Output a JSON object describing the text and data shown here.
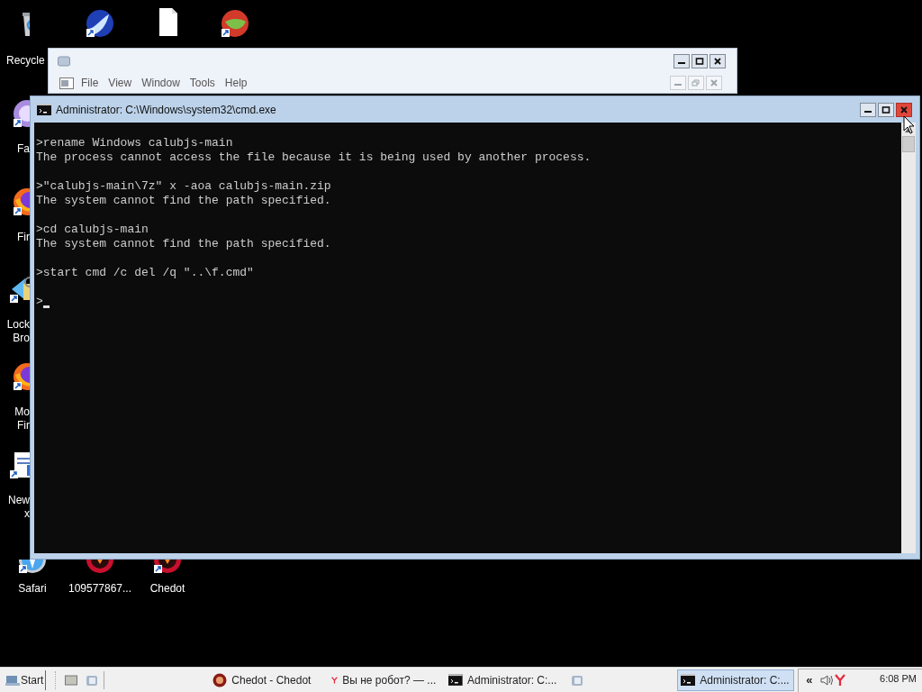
{
  "desktop_icons": [
    {
      "kind": "recycle",
      "shortcut": false,
      "label_lines": [
        "Recycle"
      ]
    },
    {
      "kind": "bird",
      "shortcut": true
    },
    {
      "kind": "document",
      "shortcut": false
    },
    {
      "kind": "chameleon",
      "shortcut": true
    },
    {
      "kind": "purple-globe",
      "shortcut": true,
      "label_lines": [
        "Fa"
      ]
    },
    {
      "kind": "firefox",
      "shortcut": true,
      "label_lines": [
        "Fir"
      ]
    },
    {
      "kind": "lock-browser",
      "shortcut": true,
      "label_lines": [
        "Lock",
        "Bro"
      ]
    },
    {
      "kind": "firefox",
      "shortcut": true,
      "label_lines": [
        "Mo",
        "Fir"
      ]
    },
    {
      "kind": "notepad",
      "shortcut": true,
      "label_lines": [
        "New",
        "x"
      ]
    },
    {
      "kind": "safari",
      "shortcut": true,
      "label_lines": [
        "Safari"
      ]
    },
    {
      "kind": "chedot",
      "shortcut": false,
      "label_lines": [
        "109577867..."
      ]
    },
    {
      "kind": "chedot",
      "shortcut": true,
      "label_lines": [
        "Chedot"
      ]
    }
  ],
  "back_window": {
    "menu": [
      "File",
      "View",
      "Window",
      "Tools",
      "Help"
    ]
  },
  "cmd_window": {
    "title": "Administrator: C:\\Windows\\system32\\cmd.exe",
    "close_hovered": true,
    "blocks": [
      {
        "command": ">rename Windows calubjs-main",
        "output": "The process cannot access the file because it is being used by another process."
      },
      {
        "command": ">\"calubjs-main\\7z\" x -aoa calubjs-main.zip",
        "output": "The system cannot find the path specified."
      },
      {
        "command": ">cd calubjs-main",
        "output": "The system cannot find the path specified."
      },
      {
        "command": ">start cmd /c del /q \"..\\f.cmd\""
      }
    ],
    "prompt": ">",
    "cursor": true
  },
  "taskbar": {
    "start": "Start",
    "tasks": [
      {
        "kind": "chedot",
        "label": "Chedot - Chedot",
        "selected": false
      },
      {
        "kind": "yandex",
        "label": "Вы не робот? — ...",
        "selected": false
      },
      {
        "kind": "cmd",
        "label": "Administrator: C:...",
        "selected": false
      },
      {
        "kind": "app",
        "selected": false
      },
      {
        "kind": "cmd",
        "label": "Administrator: C:...",
        "selected": true
      }
    ],
    "tray_expander": "«",
    "clock": "6:08 PM"
  }
}
